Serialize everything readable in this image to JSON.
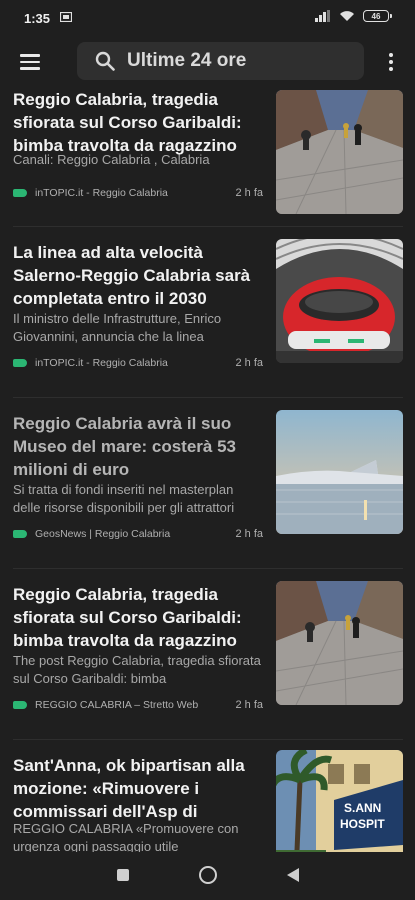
{
  "status_bar": {
    "time": "1:35",
    "battery": "46"
  },
  "search": {
    "query": "Ultime 24 ore"
  },
  "articles": [
    {
      "title": "Reggio Calabria, tragedia sfiorata sul Corso Garibaldi: bimba travolta da ragazzino",
      "snippet": "Canali: Reggio Calabria , Calabria",
      "source": "inTOPIC.it - Reggio Calabria",
      "age": "2 h fa",
      "image": "street-photo"
    },
    {
      "title": "La linea ad alta velocità Salerno-Reggio Calabria sarà completata entro il 2030",
      "snippet": "Il ministro delle Infrastrutture, Enrico Giovannini, annuncia che la linea",
      "source": "inTOPIC.it - Reggio Calabria",
      "age": "2 h fa",
      "image": "train-photo"
    },
    {
      "title": "Reggio Calabria avrà il suo Museo del mare: costerà 53 milioni di euro",
      "snippet": "Si tratta di fondi inseriti nel masterplan delle risorse disponibili per gli attrattori",
      "source": "GeosNews | Reggio Calabria",
      "age": "2 h fa",
      "image": "museum-photo"
    },
    {
      "title": "Reggio Calabria, tragedia sfiorata sul Corso Garibaldi: bimba travolta da ragazzino",
      "snippet": "The post Reggio Calabria, tragedia sfiorata sul Corso Garibaldi: bimba",
      "source": "REGGIO CALABRIA – Stretto Web",
      "age": "2 h fa",
      "image": "street-photo"
    },
    {
      "title": "Sant'Anna, ok bipartisan alla mozione: «Rimuovere i commissari dell'Asp di",
      "snippet": "REGGIO CALABRIA «Promuovere con urgenza ogni passaggio utile",
      "source": "",
      "age": "",
      "image": "hospital-photo",
      "image_sign": "S.ANN HOSPIT"
    }
  ]
}
